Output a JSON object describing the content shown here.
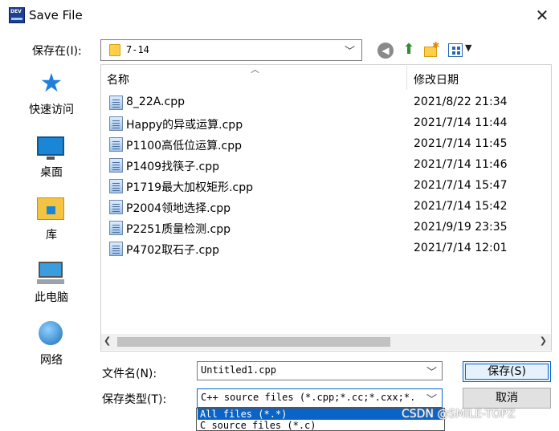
{
  "window": {
    "title": "Save File",
    "icon": "devcpp-app-icon",
    "app_icon_text": "DEV",
    "close_glyph": "✕"
  },
  "toolbar": {
    "save_in_label": "保存在(I):",
    "location": "7-14",
    "back_icon": "back-arrow-icon",
    "up_icon": "up-folder-icon",
    "new_folder_icon": "new-folder-icon",
    "view_icon": "view-menu-icon"
  },
  "places": [
    {
      "label": "快速访问",
      "icon": "star-icon"
    },
    {
      "label": "桌面",
      "icon": "desktop-icon"
    },
    {
      "label": "库",
      "icon": "library-icon"
    },
    {
      "label": "此电脑",
      "icon": "computer-icon"
    },
    {
      "label": "网络",
      "icon": "network-icon"
    }
  ],
  "filelist": {
    "columns": {
      "name": "名称",
      "date": "修改日期"
    },
    "files": [
      {
        "name": "8_22A.cpp",
        "date": "2021/8/22 21:34"
      },
      {
        "name": "Happy的异或运算.cpp",
        "date": "2021/7/14 11:44"
      },
      {
        "name": "P1100高低位运算.cpp",
        "date": "2021/7/14 11:45"
      },
      {
        "name": "P1409找筷子.cpp",
        "date": "2021/7/14 11:46"
      },
      {
        "name": "P1719最大加权矩形.cpp",
        "date": "2021/7/14 15:47"
      },
      {
        "name": "P2004领地选择.cpp",
        "date": "2021/7/14 15:42"
      },
      {
        "name": "P2251质量检测.cpp",
        "date": "2021/9/19 23:35"
      },
      {
        "name": "P4702取石子.cpp",
        "date": "2021/7/14 12:01"
      }
    ]
  },
  "form": {
    "filename_label": "文件名(N):",
    "filename_value": "Untitled1.cpp",
    "filetype_label": "保存类型(T):",
    "filetype_value": "C++ source files (*.cpp;*.cc;*.cxx;*.",
    "filetype_options": [
      "All files (*.*)",
      "C source files (*.c)"
    ],
    "save_label": "保存(S)",
    "cancel_label": "取消"
  },
  "watermark": "CSDN @SMILE-TOPZ",
  "colors": {
    "accent": "#0a64c8",
    "folder": "#ffcf48"
  }
}
